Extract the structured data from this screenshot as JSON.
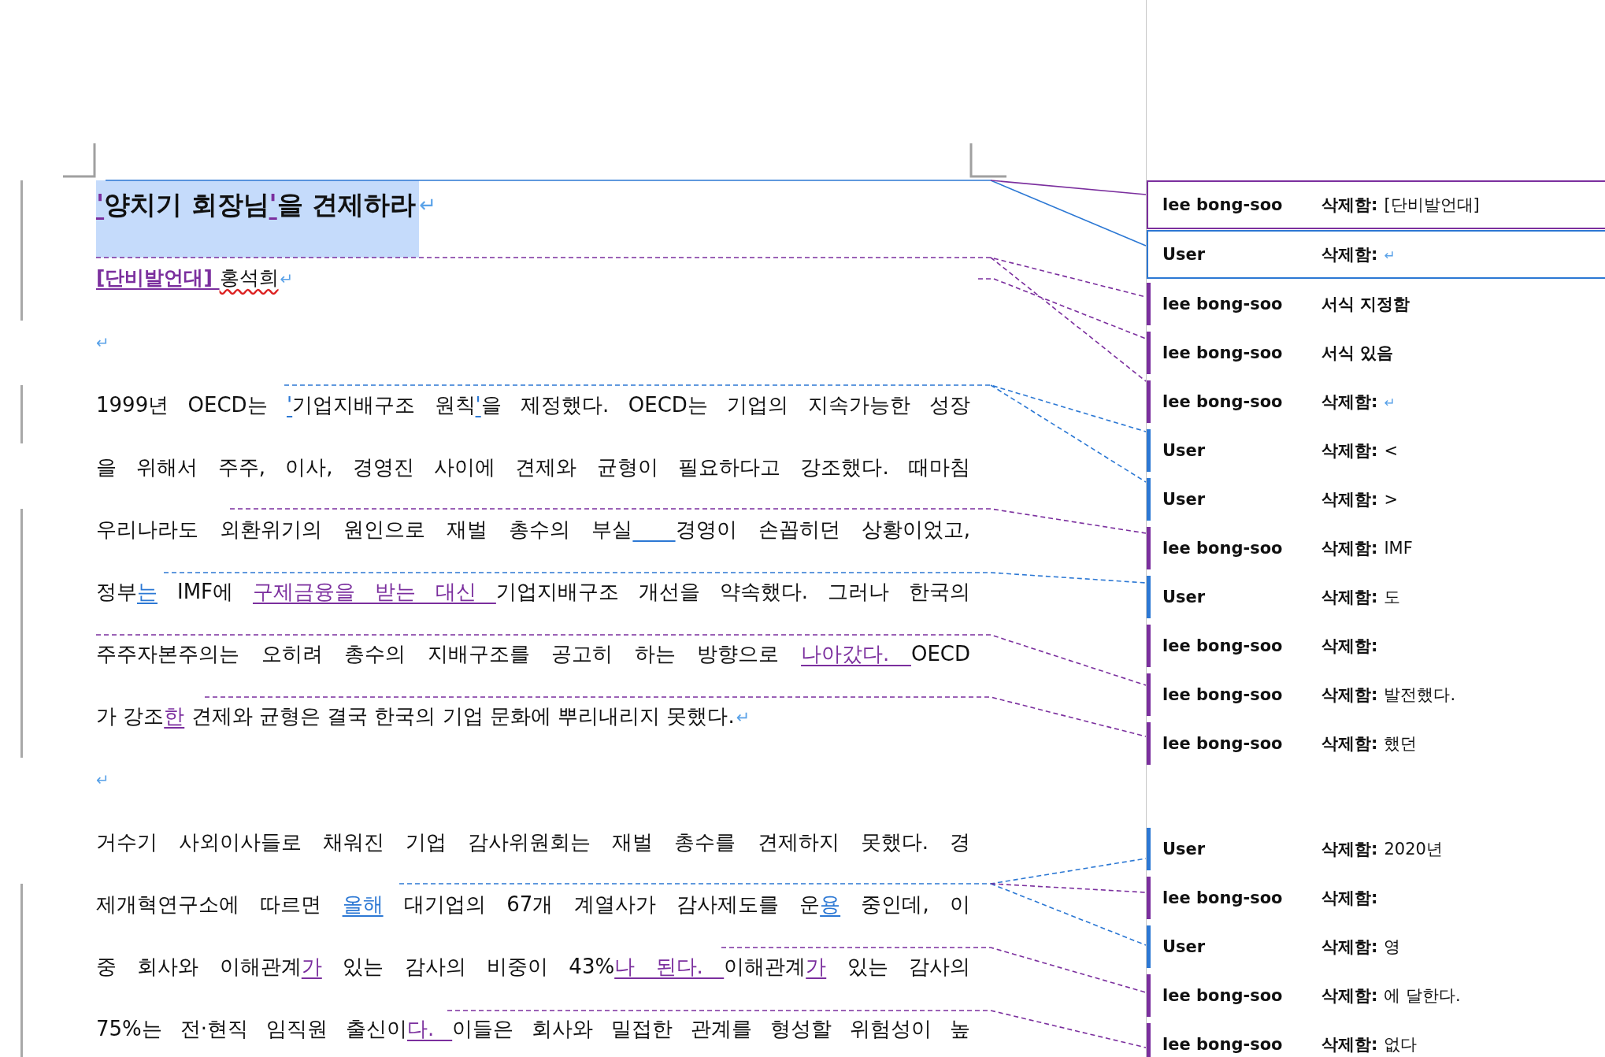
{
  "document": {
    "paragraphs": [
      {
        "kind": "title",
        "highlighted": true,
        "mark": "↵",
        "lines": [
          [
            {
              "text": "'",
              "color": "#7b2f9e"
            },
            {
              "text": "양치기 회장님"
            },
            {
              "text": "'",
              "color": "#7b2f9e"
            },
            {
              "text": "을 견제하라"
            }
          ]
        ]
      },
      {
        "kind": "byline",
        "mark": "↵",
        "lines": [
          [
            {
              "text": "[단비발언대] ",
              "color": "#7b2f9e",
              "bold": true
            },
            {
              "text": "홍석희",
              "spelling_error": true
            }
          ]
        ]
      },
      {
        "kind": "empty",
        "mark": "↵"
      },
      {
        "kind": "body",
        "mark": "↵",
        "lines": [
          [
            {
              "text": "1999년 OECD는 "
            },
            {
              "text": "'",
              "color": "#2c78d4"
            },
            {
              "text": "기업지배구조 원칙"
            },
            {
              "text": "'",
              "color": "#2c78d4"
            },
            {
              "text": "을 제정했다. OECD는 기업의 지속가능한 성장"
            }
          ],
          [
            {
              "text": "을 위해서 주주, 이사, 경영진 사이에 견제와 균형이 필요하다고 강조했다. 때마침"
            }
          ],
          [
            {
              "text": "우리나라도 외환위기의 원인으로 재벌 총수의 부실"
            },
            {
              "kind": "inserted_space",
              "color": "#2c78d4"
            },
            {
              "text": "경영이 손꼽히던 상황이었고,"
            }
          ],
          [
            {
              "text": "정부"
            },
            {
              "text": "는",
              "color": "#2c78d4"
            },
            {
              "text": " IMF에 "
            },
            {
              "text": "구제금융을 받는 대신 ",
              "color": "#7b2f9e"
            },
            {
              "text": "기업지배구조 개선을 약속했다. 그러나 한국의"
            }
          ],
          [
            {
              "text": "주주자본주의는 오히려 총수의 지배구조를 공고히 하는 방향으로 "
            },
            {
              "text": "나아갔다. ",
              "color": "#7b2f9e"
            },
            {
              "text": "OECD"
            }
          ],
          [
            {
              "text": "가 강조"
            },
            {
              "text": "한",
              "color": "#7b2f9e"
            },
            {
              "text": " 견제와 균형은 결국 한국의 기업 문화에 뿌리내리지 못했다."
            }
          ]
        ]
      },
      {
        "kind": "empty",
        "mark": "↵"
      },
      {
        "kind": "body",
        "lines": [
          [
            {
              "text": "거수기 사외이사들로 채워진 기업 감사위원회는 재벌 총수를 견제하지 못했다. 경"
            }
          ],
          [
            {
              "text": "제개혁연구소에 따르면 "
            },
            {
              "text": "올해",
              "color": "#2c78d4"
            },
            {
              "text": " 대기업의 67개 계열사가 감사제도를 운"
            },
            {
              "text": "용",
              "color": "#2c78d4"
            },
            {
              "text": " 중인데, 이"
            }
          ],
          [
            {
              "text": "중 회사와 이해관계"
            },
            {
              "text": "가",
              "color": "#7b2f9e"
            },
            {
              "text": " 있는 감사의 비중이 43%"
            },
            {
              "text": "나 된다. ",
              "color": "#7b2f9e"
            },
            {
              "text": "이해관계"
            },
            {
              "text": "가",
              "color": "#7b2f9e"
            },
            {
              "text": " 있는 감사의"
            }
          ],
          [
            {
              "text": "75%는 전·현직 임직원 출신이"
            },
            {
              "text": "다. ",
              "color": "#7b2f9e"
            },
            {
              "text": "이들은 회사와 밀접한 관계를 형성할 위험성이 높"
            }
          ]
        ]
      }
    ]
  },
  "balloon_groups": [
    [
      {
        "author": "lee bong-soo",
        "color": "#7b2f9e",
        "selected": true,
        "kind": "deletion",
        "label": "삭제함:",
        "text": "[단비발언대]"
      },
      {
        "author": "User",
        "color": "#2c78d4",
        "selected": true,
        "kind": "mark_deletion",
        "label": "삭제함:",
        "text": "↵"
      },
      {
        "author": "lee bong-soo",
        "color": "#7b2f9e",
        "selected": false,
        "kind": "formatting",
        "label": "서식 지정함"
      },
      {
        "author": "lee bong-soo",
        "color": "#7b2f9e",
        "selected": false,
        "kind": "formatting",
        "label": "서식 있음"
      },
      {
        "author": "lee bong-soo",
        "color": "#7b2f9e",
        "selected": false,
        "kind": "mark_deletion",
        "label": "삭제함:",
        "text": "↵"
      },
      {
        "author": "User",
        "color": "#2c78d4",
        "selected": false,
        "kind": "deletion",
        "label": "삭제함:",
        "text": "<"
      },
      {
        "author": "User",
        "color": "#2c78d4",
        "selected": false,
        "kind": "deletion",
        "label": "삭제함:",
        "text": ">"
      },
      {
        "author": "lee bong-soo",
        "color": "#7b2f9e",
        "selected": false,
        "kind": "deletion",
        "label": "삭제함:",
        "text": "IMF"
      },
      {
        "author": "User",
        "color": "#2c78d4",
        "selected": false,
        "kind": "deletion",
        "label": "삭제함:",
        "text": "도"
      },
      {
        "author": "lee bong-soo",
        "color": "#7b2f9e",
        "selected": false,
        "kind": "formatting",
        "label": "삭제함:"
      },
      {
        "author": "lee bong-soo",
        "color": "#7b2f9e",
        "selected": false,
        "kind": "deletion",
        "label": "삭제함:",
        "text": "발전했다."
      },
      {
        "author": "lee bong-soo",
        "color": "#7b2f9e",
        "selected": false,
        "kind": "deletion",
        "label": "삭제함:",
        "text": "했던"
      }
    ],
    [
      {
        "author": "User",
        "color": "#2c78d4",
        "selected": false,
        "kind": "deletion",
        "label": "삭제함:",
        "text": "2020년"
      },
      {
        "author": "lee bong-soo",
        "color": "#7b2f9e",
        "selected": false,
        "kind": "formatting",
        "label": "삭제함:"
      },
      {
        "author": "User",
        "color": "#2c78d4",
        "selected": false,
        "kind": "deletion",
        "label": "삭제함:",
        "text": "영"
      },
      {
        "author": "lee bong-soo",
        "color": "#7b2f9e",
        "selected": false,
        "kind": "deletion",
        "label": "삭제함:",
        "text": "에 달한다."
      },
      {
        "author": "lee bong-soo",
        "color": "#7b2f9e",
        "selected": false,
        "kind": "deletion",
        "label": "삭제함:",
        "text": "없다"
      }
    ]
  ]
}
